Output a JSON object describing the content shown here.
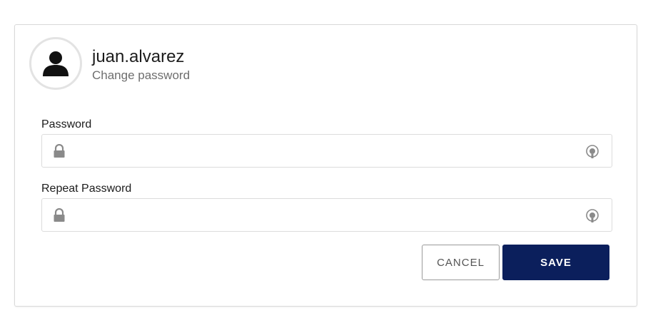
{
  "profile": {
    "username": "juan.alvarez",
    "subtitle": "Change password",
    "avatar_icon": "user-icon"
  },
  "form": {
    "password": {
      "label": "Password",
      "value": "",
      "placeholder": "",
      "left_icon": "lock-icon",
      "right_icon": "eye-reveal-icon"
    },
    "repeat_password": {
      "label": "Repeat Password",
      "value": "",
      "placeholder": "",
      "left_icon": "lock-icon",
      "right_icon": "eye-reveal-icon"
    }
  },
  "actions": {
    "cancel_label": "CANCEL",
    "save_label": "SAVE"
  },
  "colors": {
    "save_background": "#0b1f5c",
    "icon_gray": "#8a8a8a",
    "avatar_ring": "#e3e3e3"
  }
}
